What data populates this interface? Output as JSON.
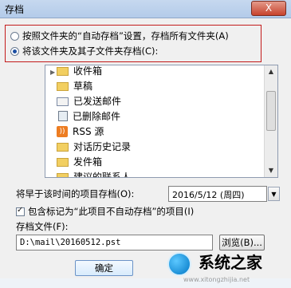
{
  "window": {
    "title": "存档",
    "close_label": "X"
  },
  "radio_options": [
    {
      "label": "按照文件夹的“自动存档”设置，存档所有文件夹(A)",
      "checked": false
    },
    {
      "label": "将该文件夹及其子文件夹存档(C):",
      "checked": true
    }
  ],
  "folders": [
    {
      "label": "收件箱",
      "icon": "folder-icon"
    },
    {
      "label": "草稿",
      "icon": "folder-icon"
    },
    {
      "label": "已发送邮件",
      "icon": "envelope-icon"
    },
    {
      "label": "已删除邮件",
      "icon": "trash-icon"
    },
    {
      "label": "RSS 源",
      "icon": "rss-icon"
    },
    {
      "label": "对话历史记录",
      "icon": "folder-icon"
    },
    {
      "label": "发件箱",
      "icon": "folder-icon"
    },
    {
      "label": "建议的联系人",
      "icon": "folder-icon"
    }
  ],
  "date_field": {
    "label": "将早于该时间的项目存档(O):",
    "value": "2016/5/12 (周四)"
  },
  "checkbox": {
    "label": "包含标记为“此项目不自动存档”的项目(I)",
    "checked": true
  },
  "archive_file": {
    "label": "存档文件(F):",
    "value": "D:\\mail\\20160512.pst",
    "browse_label": "浏览(B)..."
  },
  "buttons": {
    "ok_label": "确定"
  },
  "watermark": {
    "brand": "系统之家",
    "url": "www.xitongzhijia.net"
  },
  "colors": {
    "highlight_border": "#c31b1b",
    "title_bar": "#c6d8ef"
  }
}
